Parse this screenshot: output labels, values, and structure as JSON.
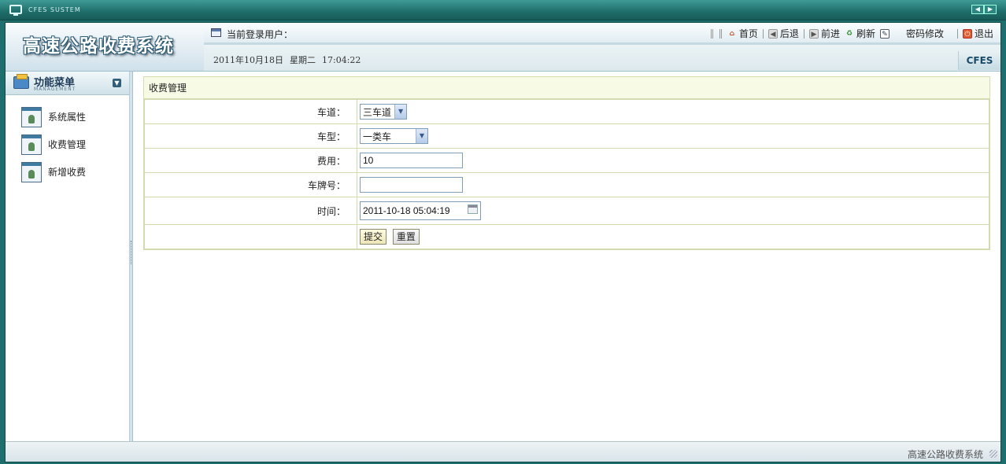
{
  "window": {
    "title": "CFES SUSTEM"
  },
  "header": {
    "app_title": "高速公路收费系统",
    "user_label": "当前登录用户：",
    "date_text": "2011年10月18日",
    "weekday": "星期二",
    "time": "17:04:22",
    "brand": "CFES"
  },
  "toolbar": {
    "home": "首页",
    "back": "后退",
    "forward": "前进",
    "refresh": "刷新",
    "change_password": "密码修改",
    "logout": "退出"
  },
  "sidebar": {
    "title": "功能菜单",
    "subtitle": "MANAGEMENT",
    "items": [
      {
        "label": "系统属性"
      },
      {
        "label": "收费管理"
      },
      {
        "label": "新增收费"
      }
    ]
  },
  "panel": {
    "title": "收费管理",
    "fields": {
      "lane": {
        "label": "车道：",
        "value": "三车道"
      },
      "vehicle_type": {
        "label": "车型：",
        "value": "一类车"
      },
      "fee": {
        "label": "费用：",
        "value": "10"
      },
      "plate": {
        "label": "车牌号：",
        "value": ""
      },
      "time": {
        "label": "时间：",
        "value": "2011-10-18 05:04:19"
      }
    },
    "submit": "提交",
    "reset": "重置"
  },
  "status": {
    "text": "高速公路收费系统"
  }
}
